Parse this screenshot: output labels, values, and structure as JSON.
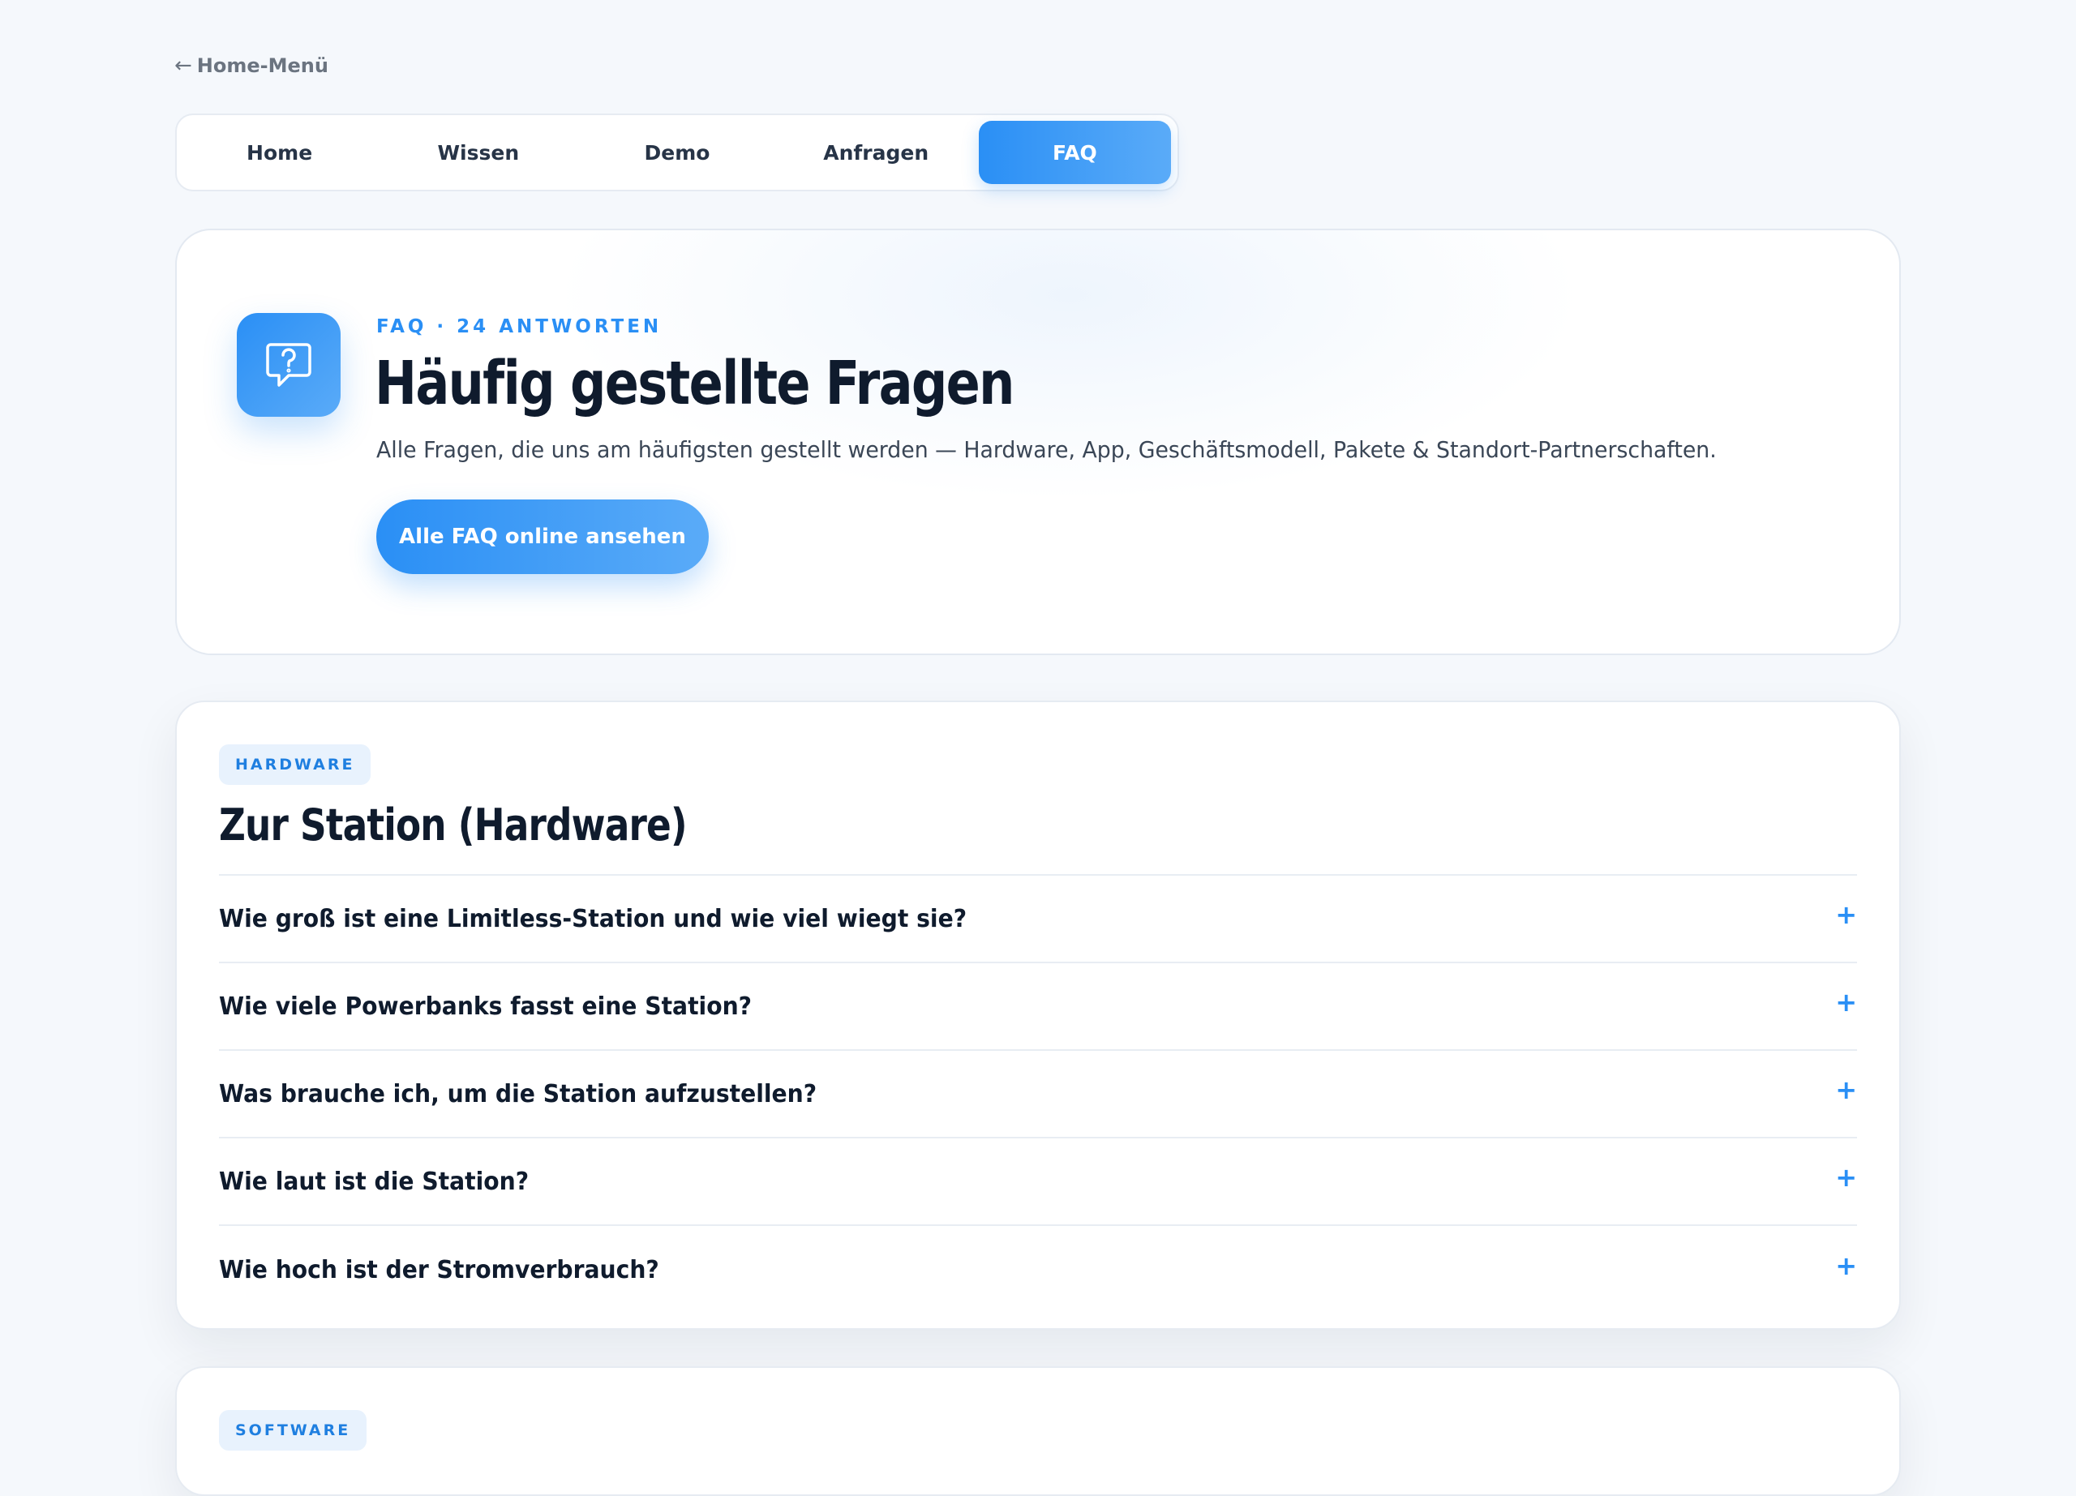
{
  "back_link": {
    "arrow": "←",
    "label": "Home-Menü"
  },
  "nav": {
    "tabs": [
      {
        "label": "Home"
      },
      {
        "label": "Wissen"
      },
      {
        "label": "Demo"
      },
      {
        "label": "Anfragen"
      },
      {
        "label": "FAQ",
        "active": true
      }
    ]
  },
  "hero": {
    "icon": "question-chat-icon",
    "eyebrow": "FAQ · 24 ANTWORTEN",
    "title": "Häufig gestellte Fragen",
    "description": "Alle Fragen, die uns am häufigsten gestellt werden — Hardware, App, Geschäftsmodell, Pakete & Standort-Partnerschaften.",
    "button_label": "Alle FAQ online ansehen"
  },
  "sections": [
    {
      "badge": "HARDWARE",
      "title": "Zur Station (Hardware)",
      "questions": [
        "Wie groß ist eine Limitless-Station und wie viel wiegt sie?",
        "Wie viele Powerbanks fasst eine Station?",
        "Was brauche ich, um die Station aufzustellen?",
        "Wie laut ist die Station?",
        "Wie hoch ist der Stromverbrauch?"
      ],
      "toggle_symbol": "+"
    },
    {
      "badge": "SOFTWARE"
    }
  ],
  "colors": {
    "accent": "#2a8ff5",
    "accent_light": "#5aabf8",
    "background": "#f5f8fc",
    "text": "#0f1b2d",
    "badge_bg": "#e8f2fd"
  }
}
